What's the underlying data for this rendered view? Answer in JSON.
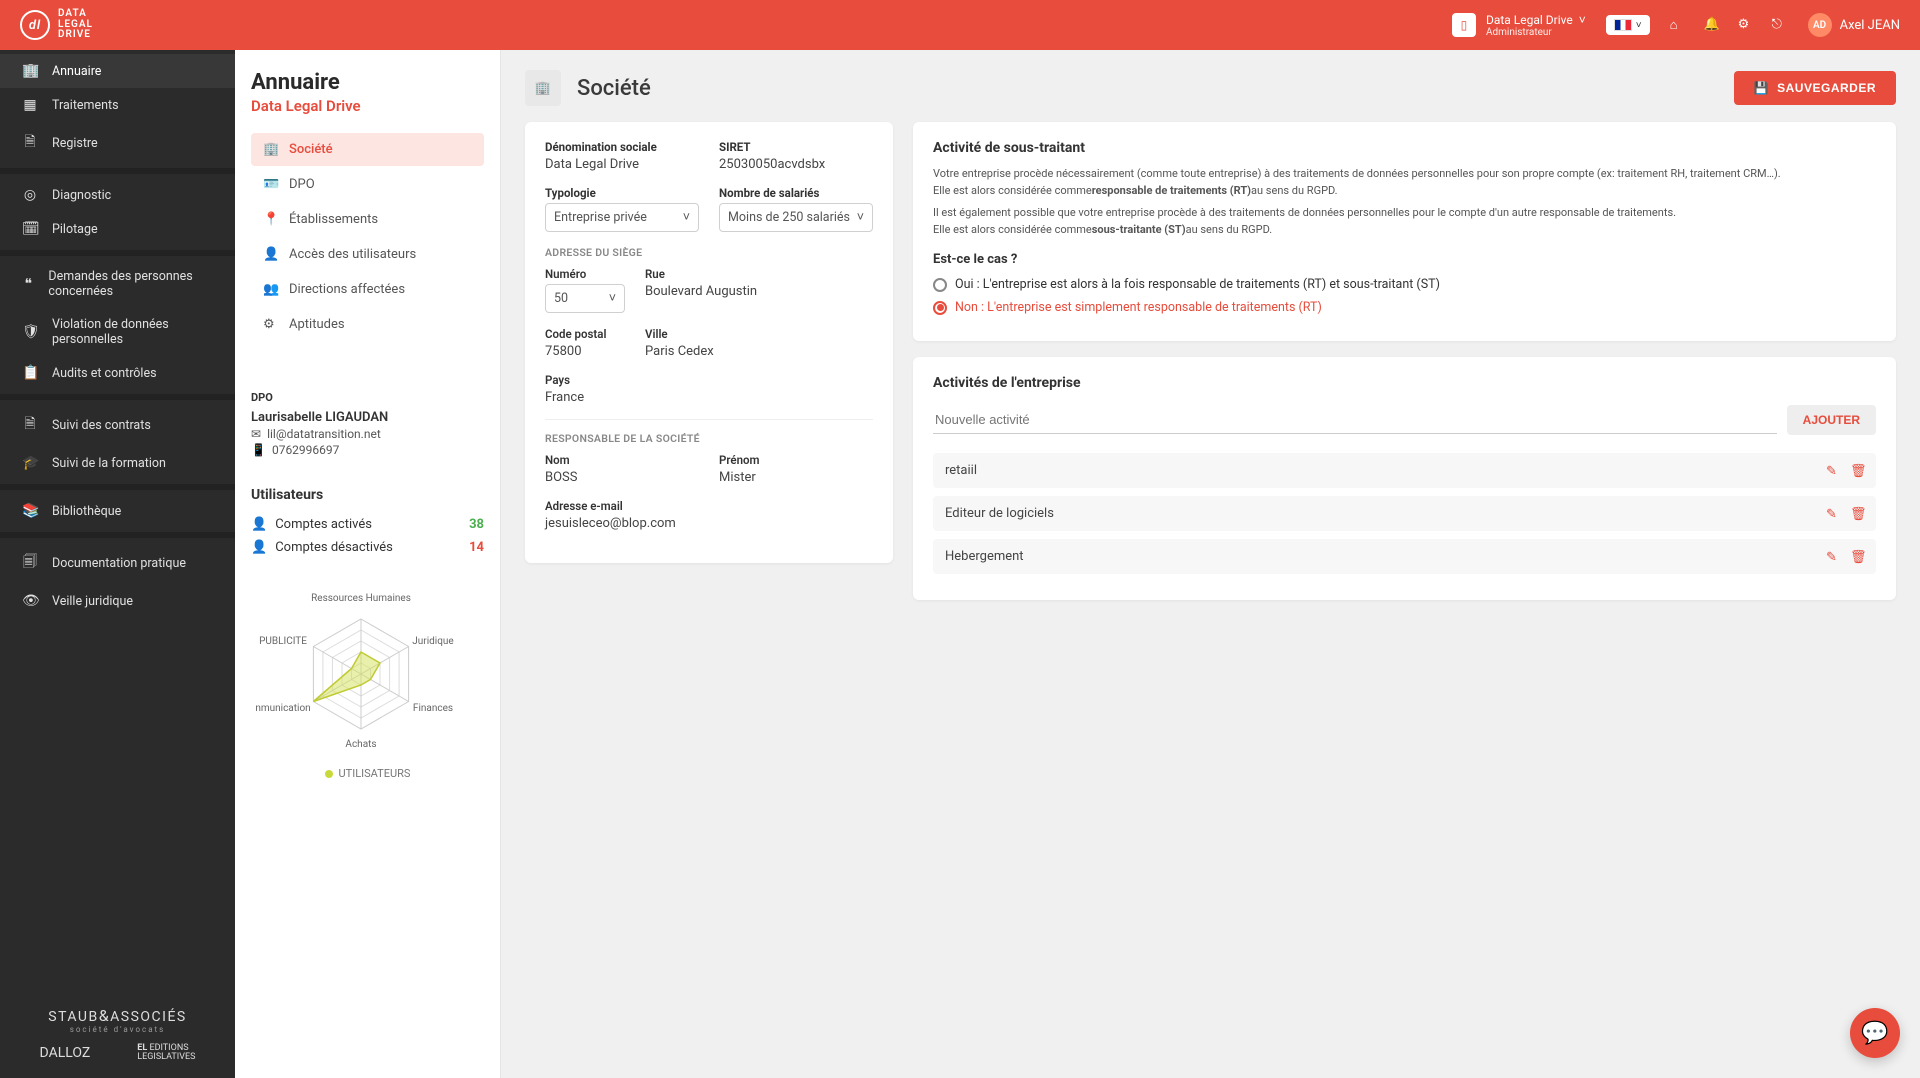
{
  "header": {
    "logo_text": "DATA\nLEGAL\nDRIVE",
    "org_name": "Data Legal Drive",
    "org_role": "Administrateur",
    "user_initials": "AD",
    "user_name": "Axel JEAN"
  },
  "sidebar": {
    "items": [
      {
        "label": "Annuaire",
        "icon": "building"
      },
      {
        "label": "Traitements",
        "icon": "grid"
      },
      {
        "label": "Registre",
        "icon": "doc"
      },
      {
        "label": "Diagnostic",
        "icon": "target"
      },
      {
        "label": "Pilotage",
        "icon": "calendar"
      },
      {
        "label": "Demandes des personnes concernées",
        "icon": "quote"
      },
      {
        "label": "Violation de données personnelles",
        "icon": "shield"
      },
      {
        "label": "Audits et contrôles",
        "icon": "clipboard"
      },
      {
        "label": "Suivi des contrats",
        "icon": "file"
      },
      {
        "label": "Suivi de la formation",
        "icon": "grad"
      },
      {
        "label": "Bibliothèque",
        "icon": "book"
      },
      {
        "label": "Documentation pratique",
        "icon": "page"
      },
      {
        "label": "Veille juridique",
        "icon": "eye"
      }
    ],
    "footer": {
      "brand1": "STAUB & ASSOCIÉS",
      "sub1": "société d'avocats",
      "brand2": "DALLOZ",
      "brand3a": "EDITIONS",
      "brand3b": "LEGISLATIVES"
    }
  },
  "panel": {
    "title": "Annuaire",
    "subtitle": "Data Legal Drive",
    "tabs": [
      {
        "label": "Société",
        "active": true
      },
      {
        "label": "DPO"
      },
      {
        "label": "Établissements"
      },
      {
        "label": "Accès des utilisateurs"
      },
      {
        "label": "Directions affectées"
      },
      {
        "label": "Aptitudes"
      }
    ],
    "dpo": {
      "hd": "DPO",
      "name": "Laurisabelle LIGAUDAN",
      "email": "lil@datatransition.net",
      "phone": "0762996697"
    },
    "users": {
      "hd": "Utilisateurs",
      "act_label": "Comptes activés",
      "act_val": "38",
      "deact_label": "Comptes désactivés",
      "deact_val": "14"
    },
    "radar": {
      "labels": [
        "Ressources Humaines",
        "Juridique",
        "Finances",
        "Achats",
        "nmunication",
        "PUBLICITE"
      ],
      "legend": "UTILISATEURS"
    }
  },
  "main": {
    "title": "Société",
    "save_btn": "SAUVEGARDER",
    "fields": {
      "denom_label": "Dénomination sociale",
      "denom_val": "Data Legal Drive",
      "siret_label": "SIRET",
      "siret_val": "25030050acvdsbx",
      "typo_label": "Typologie",
      "typo_val": "Entreprise privée",
      "sal_label": "Nombre de salariés",
      "sal_val": "Moins de 250 salariés",
      "addr_hd": "ADRESSE DU SIÈGE",
      "num_label": "Numéro",
      "num_val": "50",
      "rue_label": "Rue",
      "rue_val": "Boulevard Augustin",
      "cp_label": "Code postal",
      "cp_val": "75800",
      "ville_label": "Ville",
      "ville_val": "Paris Cedex",
      "pays_label": "Pays",
      "pays_val": "France",
      "resp_hd": "RESPONSABLE DE LA SOCIÉTÉ",
      "nom_label": "Nom",
      "nom_val": "BOSS",
      "prenom_label": "Prénom",
      "prenom_val": "Mister",
      "email_label": "Adresse e-mail",
      "email_val": "jesuisleceo@blop.com"
    },
    "subproc": {
      "hd": "Activité de sous-traitant",
      "p1a": "Votre entreprise procède nécessairement (comme toute entreprise) à des traitements de données personnelles pour son propre compte (ex: traitement RH, traitement CRM…).",
      "p1b_pre": "Elle est alors considérée comme",
      "p1b_bold": "responsable de traitements (RT)",
      "p1b_post": "au sens du RGPD.",
      "p2a": "Il est également possible que votre entreprise procède à des traitements de données personnelles pour le compte d'un autre responsable de traitements.",
      "p2b_pre": "Elle est alors considérée comme",
      "p2b_bold": "sous-traitante (ST)",
      "p2b_post": "au sens du RGPD.",
      "question": "Est-ce le cas ?",
      "opt_yes": "Oui : L'entreprise est alors à la fois responsable de traitements (RT) et sous-traitant (ST)",
      "opt_no": "Non : L'entreprise est simplement responsable de traitements (RT)"
    },
    "activities": {
      "hd": "Activités de l'entreprise",
      "placeholder": "Nouvelle activité",
      "add_btn": "AJOUTER",
      "items": [
        "retaiil",
        "Editeur de logiciels",
        "Hebergement"
      ]
    }
  },
  "chart_data": {
    "type": "radar",
    "categories": [
      "Ressources Humaines",
      "Juridique",
      "Finances",
      "Achats",
      "Communication",
      "PUBLICITE"
    ],
    "series": [
      {
        "name": "UTILISATEURS",
        "values": [
          2,
          2,
          1,
          1,
          5,
          1
        ]
      }
    ],
    "max": 5
  }
}
